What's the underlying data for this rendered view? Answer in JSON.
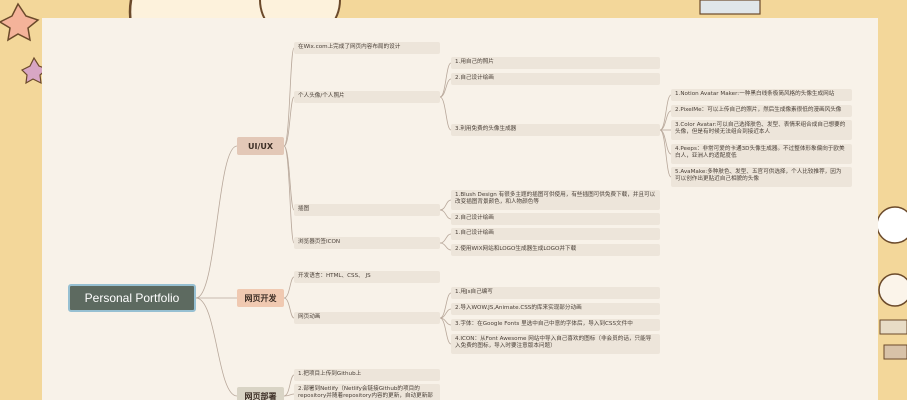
{
  "root": {
    "label": "Personal Portfolio"
  },
  "uiux": {
    "label": "UI/UX",
    "wix": "在Wix.com上完成了网页内容布局的设计",
    "avatar": "个人头像/个人照片",
    "avatar_own": "1.用自己的照片",
    "avatar_draw": "2.自己设计绘画",
    "avatar_gen": "3.利用免费的头像生成器",
    "gen1": "1.Notion Avatar Maker:一种黑白线条极简风格的头像生成网站",
    "gen2": "2.PixelMe：可以上传自己的照片，然后生成像素很低的漫画风头像",
    "gen3_a": "3.Color Avatar:可以自己选择肤色、发型、表情来组合成自己想要的",
    "gen3_b": "头像，但是有时候无法组合到接近本人",
    "gen4_a": "4.Peeps：非常可爱的卡通3D头像生成器。不过整体形象偏向于欧美",
    "gen4_b": "白人，亚洲人的适配度低",
    "gen5_a": "5.AvaMake:多种肤色、发型、五官可供选择，个人比较推荐，因为",
    "gen5_b": "可以创作出更贴近自己相貌的头像",
    "illus": "插图",
    "illus1_a": "1.Blush Design 有很多主题的插图可供使用，有些插图可供免费下载，并且可以",
    "illus1_b": "改变插图背景颜色，和人物颜色等",
    "illus2": "2.自己设计绘画",
    "favicon": "浏览器页签ICON",
    "fav1": "1.自己设计绘画",
    "fav2": "2.使用WIX网站和LOGO生成器生成LOGO并下载"
  },
  "dev": {
    "label": "网页开发",
    "lang": "开发语言：HTML、CSS、 JS",
    "anim": "网页动画",
    "anim1": "1.用Js自己编写",
    "anim2": "2.导入WOW.JS,Animate.CSS的库来实现部分动画",
    "anim3": "3.字体：在Google Fonts 里选中自己中意的字体后，导入到CSS文件中",
    "anim4_a": "4.ICON：从Font Awesome 网站中导入自己喜欢的图标（非会员的话，只能导",
    "anim4_b": "入免费的图标，导入时要注意版本问题）"
  },
  "deploy": {
    "label": "网页部署",
    "d1": "1.把项目上传到Github上",
    "d2_a": "2.部署到Netlify（Netlify会链接Github的项目的",
    "d2_b": "repository并随着repository内容的更新，自动更新部"
  },
  "colors": {
    "page_bg": "#f3d79a",
    "canvas_bg": "#f8f2e9",
    "root_bg": "#5d6a60",
    "root_border": "#97c0d2",
    "uiux_bg": "#e3c8b7",
    "dev_bg": "#f0c9b1",
    "deploy_bg": "#d9d4c5",
    "link": "#b8a89b",
    "node_bg": "#ede5da"
  }
}
